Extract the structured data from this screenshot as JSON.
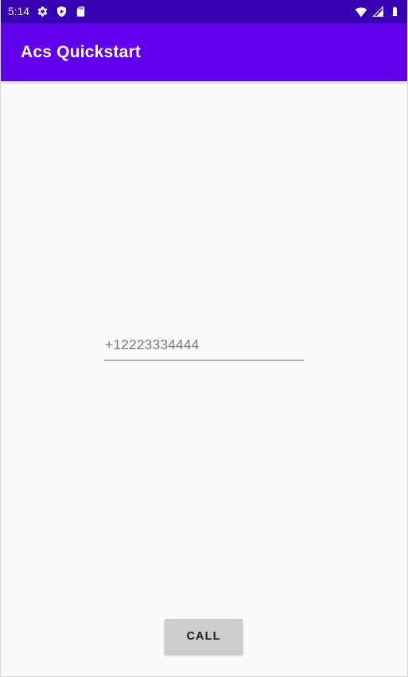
{
  "status_bar": {
    "clock": "5:14",
    "left_icons": [
      {
        "name": "gear-icon",
        "label": "Settings"
      },
      {
        "name": "play-protect-shield-icon",
        "label": "Play Protect"
      },
      {
        "name": "sd-card-icon",
        "label": "SD Card"
      }
    ],
    "right_icons": [
      {
        "name": "wifi-icon",
        "label": "Wi-Fi"
      },
      {
        "name": "cellular-signal-icon",
        "label": "Cellular signal"
      },
      {
        "name": "battery-icon",
        "label": "Battery full"
      }
    ],
    "background_color": "#3700b3",
    "foreground_color": "#ffffff"
  },
  "app_bar": {
    "title": "Acs Quickstart",
    "background_color": "#6200ee",
    "title_color": "#ffffff"
  },
  "main": {
    "background_color": "#fafafa",
    "phone_field": {
      "value": "+12223334444",
      "placeholder": "+12223334444",
      "text_color": "#7c7c80",
      "underline_color": "#b0b2b5"
    },
    "call_button": {
      "label": "CALL",
      "background_color": "#cccccc",
      "text_color": "#1b1b1b"
    }
  }
}
